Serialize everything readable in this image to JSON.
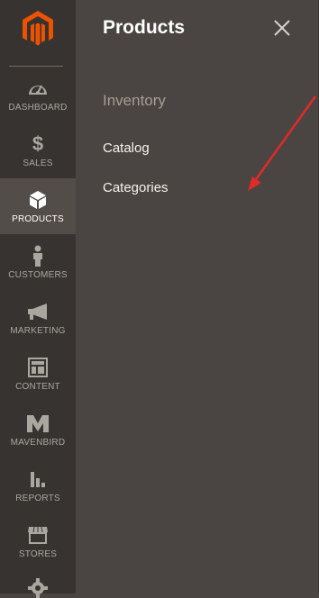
{
  "sidebar": {
    "logo_icon": "magento-logo-icon",
    "items": [
      {
        "label": "DASHBOARD",
        "icon": "dashboard-icon"
      },
      {
        "label": "SALES",
        "icon": "dollar-icon"
      },
      {
        "label": "PRODUCTS",
        "icon": "box-icon",
        "active": true
      },
      {
        "label": "CUSTOMERS",
        "icon": "person-icon"
      },
      {
        "label": "MARKETING",
        "icon": "megaphone-icon"
      },
      {
        "label": "CONTENT",
        "icon": "layout-icon"
      },
      {
        "label": "MAVENBIRD",
        "icon": "mavenbird-icon"
      },
      {
        "label": "REPORTS",
        "icon": "bar-chart-icon"
      },
      {
        "label": "STORES",
        "icon": "store-icon"
      },
      {
        "label": "",
        "icon": "gear-icon"
      }
    ]
  },
  "panel": {
    "title": "Products",
    "close_icon": "close-icon",
    "section_title": "Inventory",
    "links": [
      "Catalog",
      "Categories"
    ]
  },
  "colors": {
    "accent": "#eb5202",
    "sidebar_bg": "#373330",
    "panel_bg": "#4a4542",
    "annotation_arrow": "#e02b27"
  }
}
